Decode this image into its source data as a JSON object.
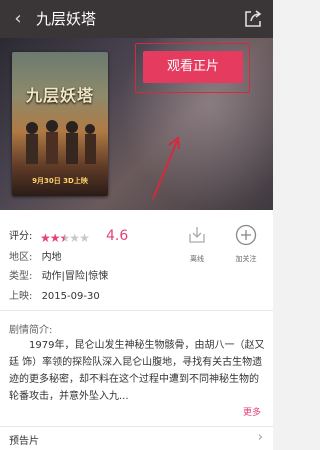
{
  "header": {
    "title": "九层妖塔",
    "back_icon": "back-arrow-icon",
    "share_icon": "share-icon"
  },
  "poster": {
    "title_text": "九层妖塔",
    "date_text": "9月30日 3D上映"
  },
  "watch_button": {
    "label": "观看正片"
  },
  "details": {
    "rating_label": "评分:",
    "rating_value": "4.6",
    "rating_fraction": 0.46,
    "region_label": "地区:",
    "region_value": "内地",
    "genre_label": "类型:",
    "genre_value": "动作|冒险|惊悚",
    "release_label": "上映:",
    "release_value": "2015-09-30"
  },
  "actions": {
    "offline_label": "离线",
    "follow_label": "加关注"
  },
  "synopsis": {
    "title": "剧情简介:",
    "body": "1979年，昆仑山发生神秘生物骸骨，由胡八一（赵又廷 饰）率领的探险队深入昆仑山腹地，寻找有关古生物遗迹的更多秘密，却不料在这个过程中遭到不同神秘生物的轮番攻击，并意外坠入九...",
    "more_label": "更多"
  },
  "trailer": {
    "label": "预告片"
  },
  "colors": {
    "accent": "#e5417a",
    "navbar": "#3a3638",
    "highlight": "#d8283b"
  }
}
